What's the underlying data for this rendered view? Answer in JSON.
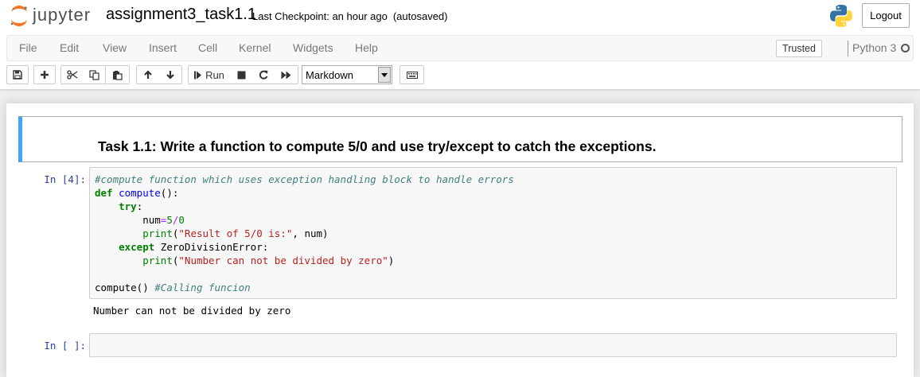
{
  "header": {
    "logo_text": "jupyter",
    "notebook_name": "assignment3_task1.1",
    "checkpoint": "Last Checkpoint: an hour ago",
    "autosave": "(autosaved)",
    "logout_label": "Logout"
  },
  "menubar": {
    "items": [
      "File",
      "Edit",
      "View",
      "Insert",
      "Cell",
      "Kernel",
      "Widgets",
      "Help"
    ],
    "trusted_label": "Trusted",
    "kernel_name": "Python 3"
  },
  "toolbar": {
    "run_label": "Run",
    "cell_type": "Markdown",
    "icons": [
      "save-icon",
      "plus-icon",
      "cut-icon",
      "copy-icon",
      "paste-icon",
      "arrow-up-icon",
      "arrow-down-icon",
      "step-forward-icon",
      "stop-icon",
      "restart-icon",
      "fast-forward-icon",
      "keyboard-icon"
    ]
  },
  "cells": {
    "markdown": {
      "text": "Task 1.1: Write a function to compute 5/0 and use try/except to catch the exceptions."
    },
    "code1": {
      "prompt": "In [4]:",
      "lines": {
        "l1_comment": "#compute function which uses exception handling block to handle errors",
        "l2_def": "def",
        "l2_name": "compute",
        "l2_rest": "():",
        "l3_try": "try",
        "l3_colon": ":",
        "l4_var": "num",
        "l4_eq": "=",
        "l4_a": "5",
        "l4_div": "/",
        "l4_b": "0",
        "l5_print": "print",
        "l5_open": "(",
        "l5_str": "\"Result of 5/0 is:\"",
        "l5_rest": ", num)",
        "l6_except": "except",
        "l6_rest": " ZeroDivisionError:",
        "l7_print": "print",
        "l7_open": "(",
        "l7_str": "\"Number can not be divided by zero\"",
        "l7_close": ")",
        "l9_call": "compute() ",
        "l9_comment": "#Calling funcion"
      },
      "output": "Number can not be divided by zero"
    },
    "code2": {
      "prompt": "In [ ]:"
    }
  }
}
